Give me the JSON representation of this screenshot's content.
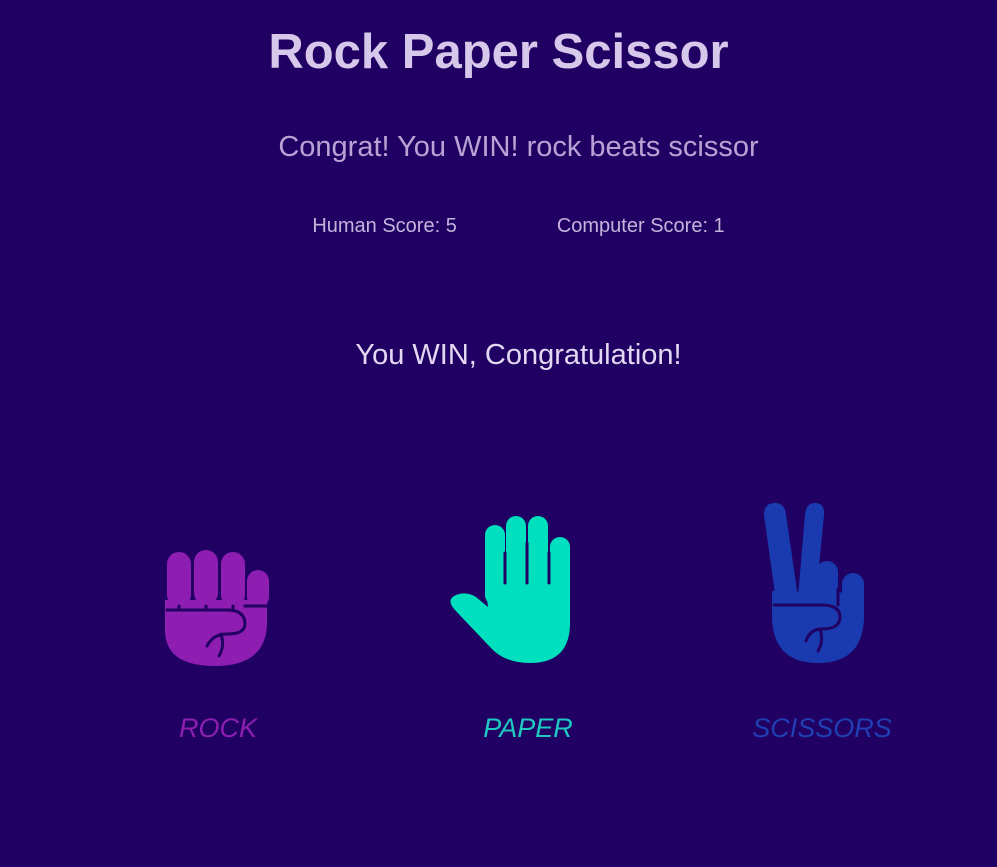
{
  "title": "Rock Paper Scissor",
  "round_message": "Congrat! You WIN! rock beats scissor",
  "scores": {
    "human_label": "Human Score: 5",
    "computer_label": "Computer Score: 1"
  },
  "final_message": "You WIN, Congratulation!",
  "choices": [
    {
      "label": "ROCK",
      "icon": "fist-icon",
      "color": "#8e1db1"
    },
    {
      "label": "PAPER",
      "icon": "open-hand-icon",
      "color": "#00e0bf"
    },
    {
      "label": "SCISSORS",
      "icon": "peace-hand-icon",
      "color": "#1a3bb0"
    }
  ],
  "colors": {
    "background": "#200062",
    "text": "#d6c8ea"
  }
}
